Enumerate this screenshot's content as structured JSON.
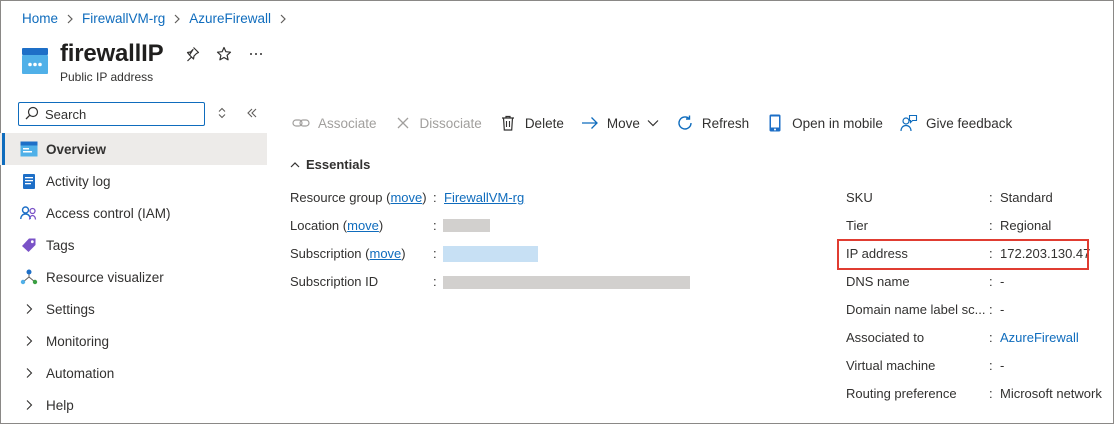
{
  "breadcrumb": [
    "Home",
    "FirewallVM-rg",
    "AzureFirewall"
  ],
  "header": {
    "title": "firewallIP",
    "subtitle": "Public IP address",
    "pin_icon": "pin-icon",
    "star_icon": "star-icon",
    "more_icon": "more-icon"
  },
  "nav": {
    "search_placeholder": "Search",
    "items": [
      {
        "label": "Overview",
        "icon": "overview-icon",
        "active": true
      },
      {
        "label": "Activity log",
        "icon": "activity-log-icon"
      },
      {
        "label": "Access control (IAM)",
        "icon": "iam-icon"
      },
      {
        "label": "Tags",
        "icon": "tag-icon"
      },
      {
        "label": "Resource visualizer",
        "icon": "resource-visualizer-icon"
      },
      {
        "label": "Settings",
        "icon": "chevron-right-icon"
      },
      {
        "label": "Monitoring",
        "icon": "chevron-right-icon"
      },
      {
        "label": "Automation",
        "icon": "chevron-right-icon"
      },
      {
        "label": "Help",
        "icon": "chevron-right-icon"
      }
    ]
  },
  "toolbar": {
    "associate": "Associate",
    "dissociate": "Dissociate",
    "delete": "Delete",
    "move": "Move",
    "refresh": "Refresh",
    "open_mobile": "Open in mobile",
    "feedback": "Give feedback"
  },
  "essentials": {
    "heading": "Essentials",
    "move_link": "move",
    "left": {
      "resource_group_label": "Resource group",
      "resource_group_value": "FirewallVM-rg",
      "location_label": "Location",
      "subscription_label": "Subscription",
      "subscription_id_label": "Subscription ID"
    },
    "right": [
      {
        "label": "SKU",
        "value": "Standard"
      },
      {
        "label": "Tier",
        "value": "Regional"
      },
      {
        "label": "IP address",
        "value": "172.203.130.47"
      },
      {
        "label": "DNS name",
        "value": "-"
      },
      {
        "label": "Domain name label sc...",
        "value": "-"
      },
      {
        "label": "Associated to",
        "value": "AzureFirewall",
        "link": true
      },
      {
        "label": "Virtual machine",
        "value": "-"
      },
      {
        "label": "Routing preference",
        "value": "Microsoft network"
      }
    ]
  },
  "colors": {
    "accent": "#0f6cbd",
    "highlight_box": "#e03c31",
    "nav_active_bg": "#edebe9"
  }
}
